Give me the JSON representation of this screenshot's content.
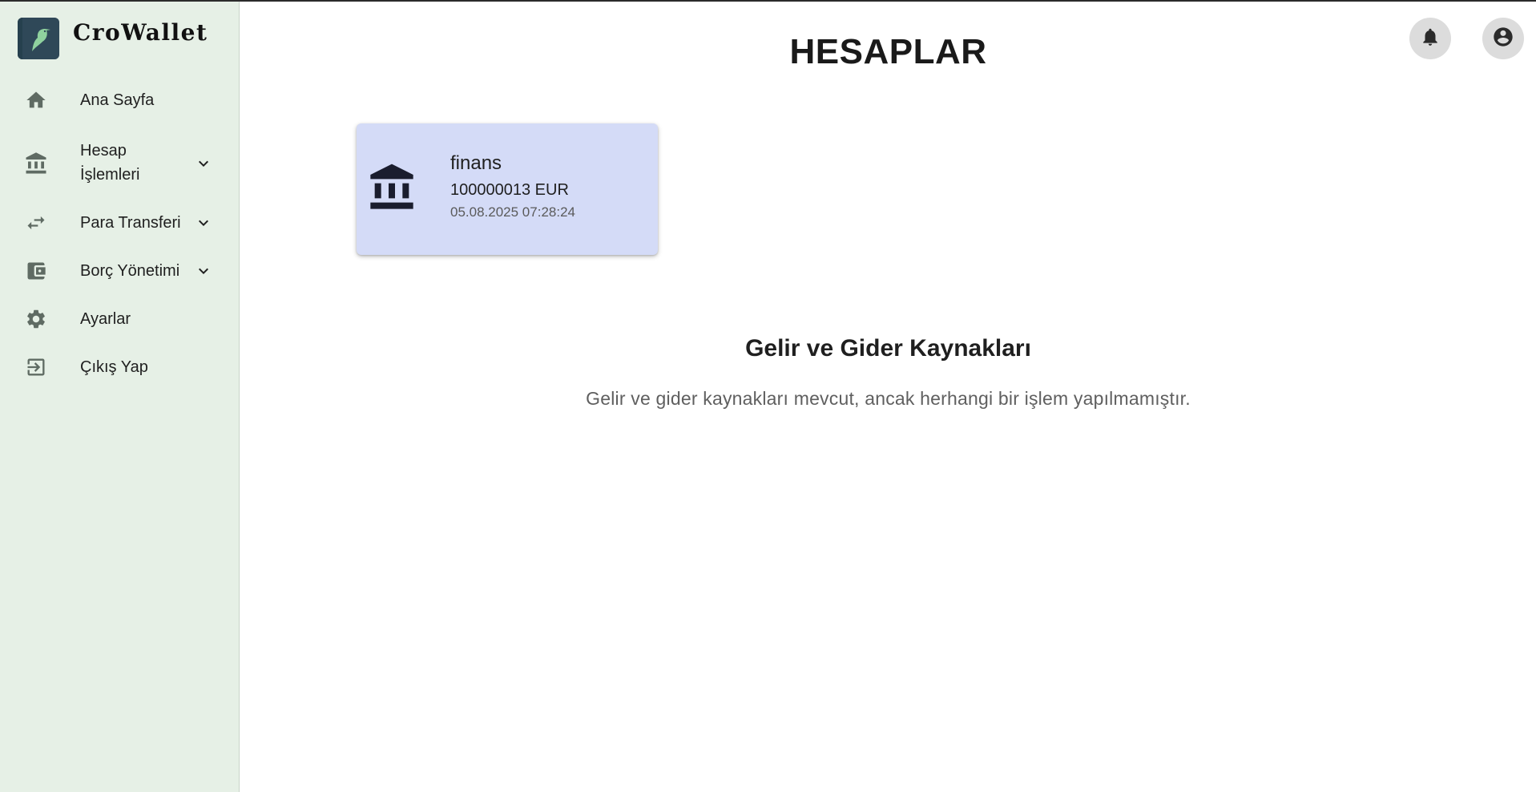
{
  "brand": {
    "name": "CroWallet",
    "logo_icon": "bird-logo-icon"
  },
  "sidebar": {
    "items": [
      {
        "label": "Ana Sayfa",
        "icon": "home-icon",
        "has_submenu": false
      },
      {
        "label_line1": "Hesap",
        "label_line2": "İşlemleri",
        "icon": "bank-icon",
        "has_submenu": true
      },
      {
        "label": "Para Transferi",
        "icon": "transfer-arrows-icon",
        "has_submenu": true
      },
      {
        "label": "Borç Yönetimi",
        "icon": "wallet-icon",
        "has_submenu": true
      },
      {
        "label": "Ayarlar",
        "icon": "gear-icon",
        "has_submenu": false
      },
      {
        "label": "Çıkış Yap",
        "icon": "logout-icon",
        "has_submenu": false
      }
    ]
  },
  "header": {
    "title": "HESAPLAR",
    "notification_icon": "bell-icon",
    "profile_icon": "account-circle-icon"
  },
  "accounts": [
    {
      "name": "finans",
      "balance": "100000013 EUR",
      "date": "05.08.2025 07:28:24",
      "icon": "bank-icon"
    }
  ],
  "income_expense": {
    "title": "Gelir ve Gider Kaynakları",
    "description": "Gelir ve gider kaynakları mevcut, ancak herhangi bir işlem yapılmamıştır."
  },
  "colors": {
    "sidebar_bg": "#e6f0e6",
    "card_bg": "#d4dbf7",
    "logo_bg": "#2f4858",
    "logo_bird": "#8fd19e",
    "icon_gray": "#5f6b63"
  }
}
